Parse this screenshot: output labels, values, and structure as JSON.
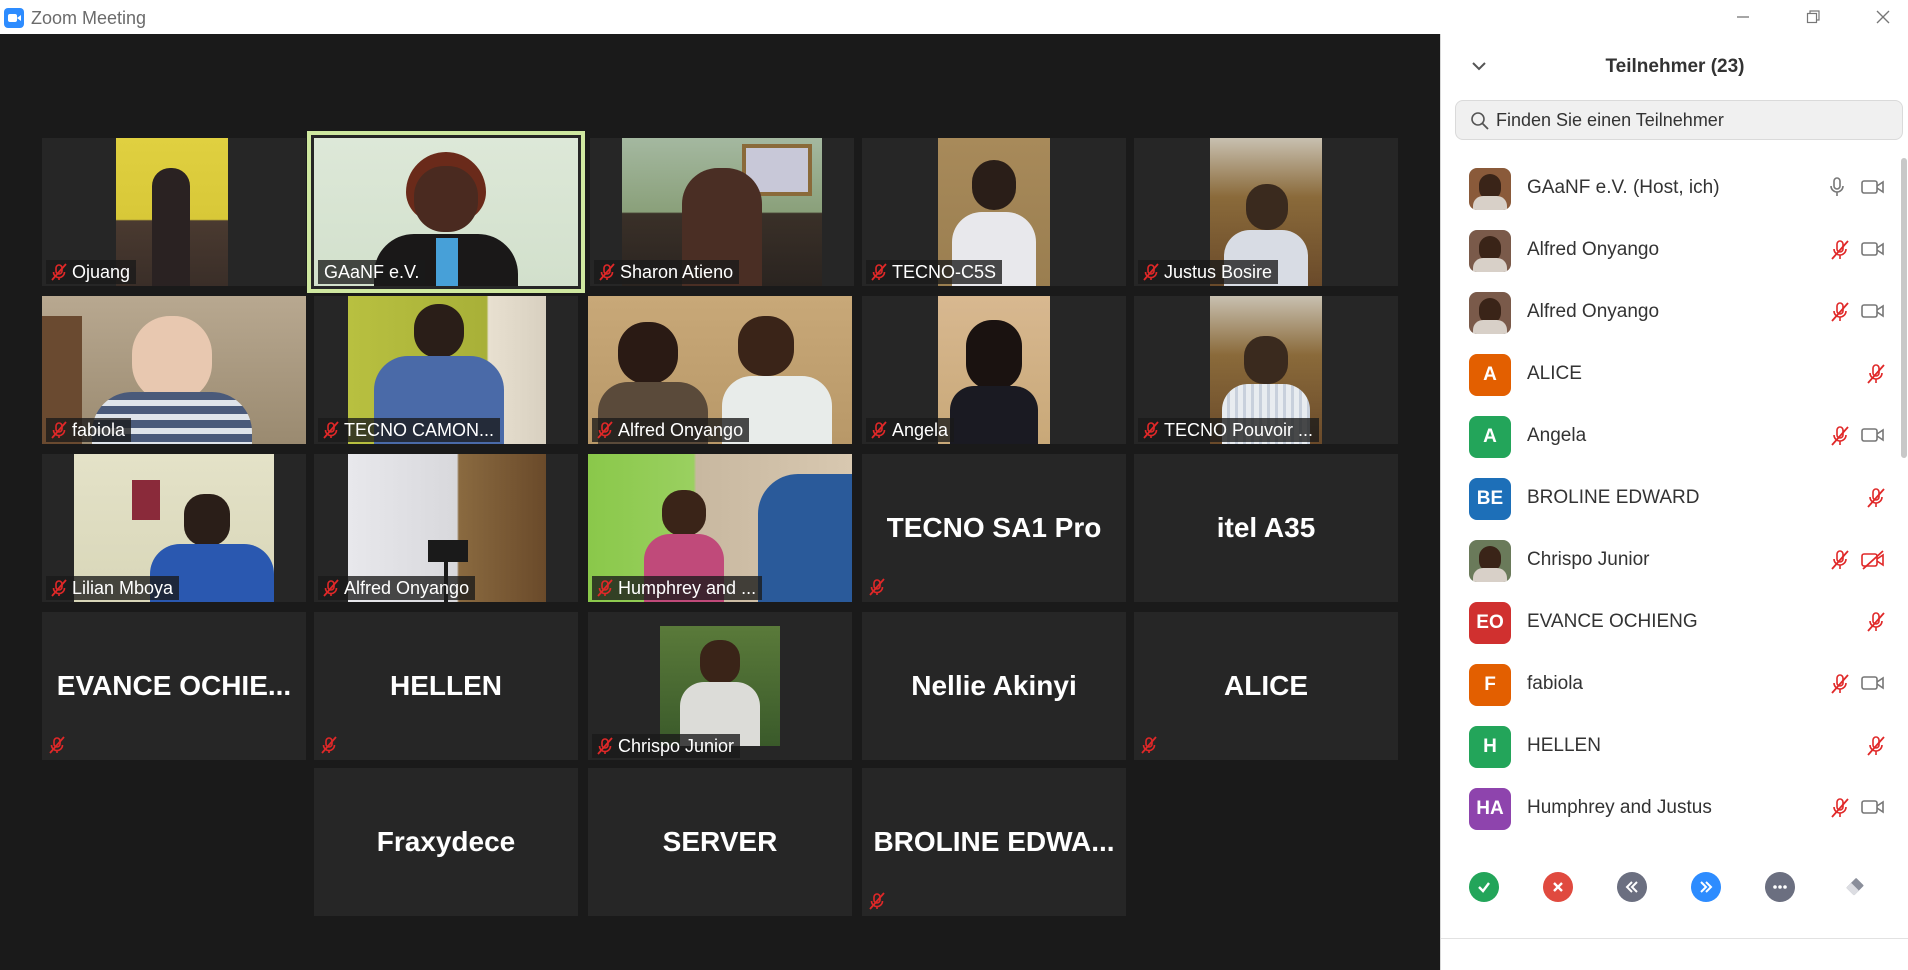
{
  "window": {
    "title": "Zoom Meeting",
    "controls": [
      "minimize-icon",
      "restore-icon",
      "close-icon"
    ]
  },
  "colors": {
    "video_bg": "#1a1a1a",
    "tile_bg": "#262626",
    "active_speaker_border": "#cfe8a0",
    "mute_red": "#e02828",
    "brand_blue": "#2d8cff"
  },
  "gallery": {
    "tiles": [
      {
        "name": "Ojuang",
        "muted": true,
        "video": true
      },
      {
        "name": "GAaNF e.V.",
        "muted": false,
        "video": true,
        "active": true
      },
      {
        "name": "Sharon Atieno",
        "muted": true,
        "video": true
      },
      {
        "name": "TECNO-C5S",
        "muted": true,
        "video": true
      },
      {
        "name": "Justus Bosire",
        "muted": true,
        "video": true
      },
      {
        "name": "fabiola",
        "muted": true,
        "video": true
      },
      {
        "name": "TECNO CAMON...",
        "muted": true,
        "video": true
      },
      {
        "name": "Alfred Onyango",
        "muted": true,
        "video": true
      },
      {
        "name": "Angela",
        "muted": true,
        "video": true
      },
      {
        "name": "TECNO Pouvoir ...",
        "muted": true,
        "video": true
      },
      {
        "name": "Lilian Mboya",
        "muted": true,
        "video": true
      },
      {
        "name": "Alfred Onyango",
        "muted": true,
        "video": true
      },
      {
        "name": "Humphrey and ...",
        "muted": true,
        "video": true
      },
      {
        "name": "TECNO SA1 Pro",
        "muted": true,
        "video": false
      },
      {
        "name": "itel A35",
        "muted": false,
        "video": false
      },
      {
        "name": "EVANCE  OCHIE...",
        "muted": true,
        "video": false
      },
      {
        "name": "HELLEN",
        "muted": true,
        "video": false
      },
      {
        "name": "Chrispo Junior",
        "muted": true,
        "video": true
      },
      {
        "name": "Nellie Akinyi",
        "muted": false,
        "video": false
      },
      {
        "name": "ALICE",
        "muted": true,
        "video": false
      },
      {
        "name": "Fraxydece",
        "muted": false,
        "video": false
      },
      {
        "name": "SERVER",
        "muted": false,
        "video": false
      },
      {
        "name": "BROLINE  EDWA...",
        "muted": true,
        "video": false
      }
    ]
  },
  "participants_panel": {
    "title": "Teilnehmer (23)",
    "search_placeholder": "Finden Sie einen Teilnehmer",
    "participants": [
      {
        "name": "GAaNF e.V. (Host, ich)",
        "avatar": "photo",
        "initials": "",
        "avatar_color": "#8a5a3a",
        "mic": "on",
        "cam": "on"
      },
      {
        "name": "Alfred Onyango",
        "avatar": "photo",
        "initials": "",
        "avatar_color": "#7a5a4a",
        "mic": "muted",
        "cam": "on"
      },
      {
        "name": "Alfred Onyango",
        "avatar": "photo",
        "initials": "",
        "avatar_color": "#7a5a4a",
        "mic": "muted",
        "cam": "on"
      },
      {
        "name": "ALICE",
        "avatar": "initials",
        "initials": "A",
        "avatar_color": "#e35f00",
        "mic": "muted",
        "cam": "none"
      },
      {
        "name": "Angela",
        "avatar": "initials",
        "initials": "A",
        "avatar_color": "#23a55a",
        "mic": "muted",
        "cam": "on"
      },
      {
        "name": "BROLINE EDWARD",
        "avatar": "initials",
        "initials": "BE",
        "avatar_color": "#1d6fb8",
        "mic": "muted",
        "cam": "none"
      },
      {
        "name": "Chrispo Junior",
        "avatar": "photo",
        "initials": "",
        "avatar_color": "#6a7a5a",
        "mic": "muted",
        "cam": "off"
      },
      {
        "name": "EVANCE OCHIENG",
        "avatar": "initials",
        "initials": "EO",
        "avatar_color": "#d0302f",
        "mic": "muted",
        "cam": "none"
      },
      {
        "name": "fabiola",
        "avatar": "initials",
        "initials": "F",
        "avatar_color": "#e35f00",
        "mic": "muted",
        "cam": "on"
      },
      {
        "name": "HELLEN",
        "avatar": "initials",
        "initials": "H",
        "avatar_color": "#23a55a",
        "mic": "muted",
        "cam": "none"
      },
      {
        "name": "Humphrey and Justus",
        "avatar": "initials",
        "initials": "HA",
        "avatar_color": "#8e44ad",
        "mic": "muted",
        "cam": "on"
      }
    ],
    "reactions": [
      {
        "name": "yes-icon",
        "color": "#23a55a"
      },
      {
        "name": "no-icon",
        "color": "#e04a3f"
      },
      {
        "name": "go-slower-icon",
        "color": "#6b6f80"
      },
      {
        "name": "go-faster-icon",
        "color": "#2d8cff"
      },
      {
        "name": "more-icon",
        "color": "#6b6f80"
      },
      {
        "name": "clear-all-icon",
        "color": "#6b6f80"
      }
    ]
  }
}
